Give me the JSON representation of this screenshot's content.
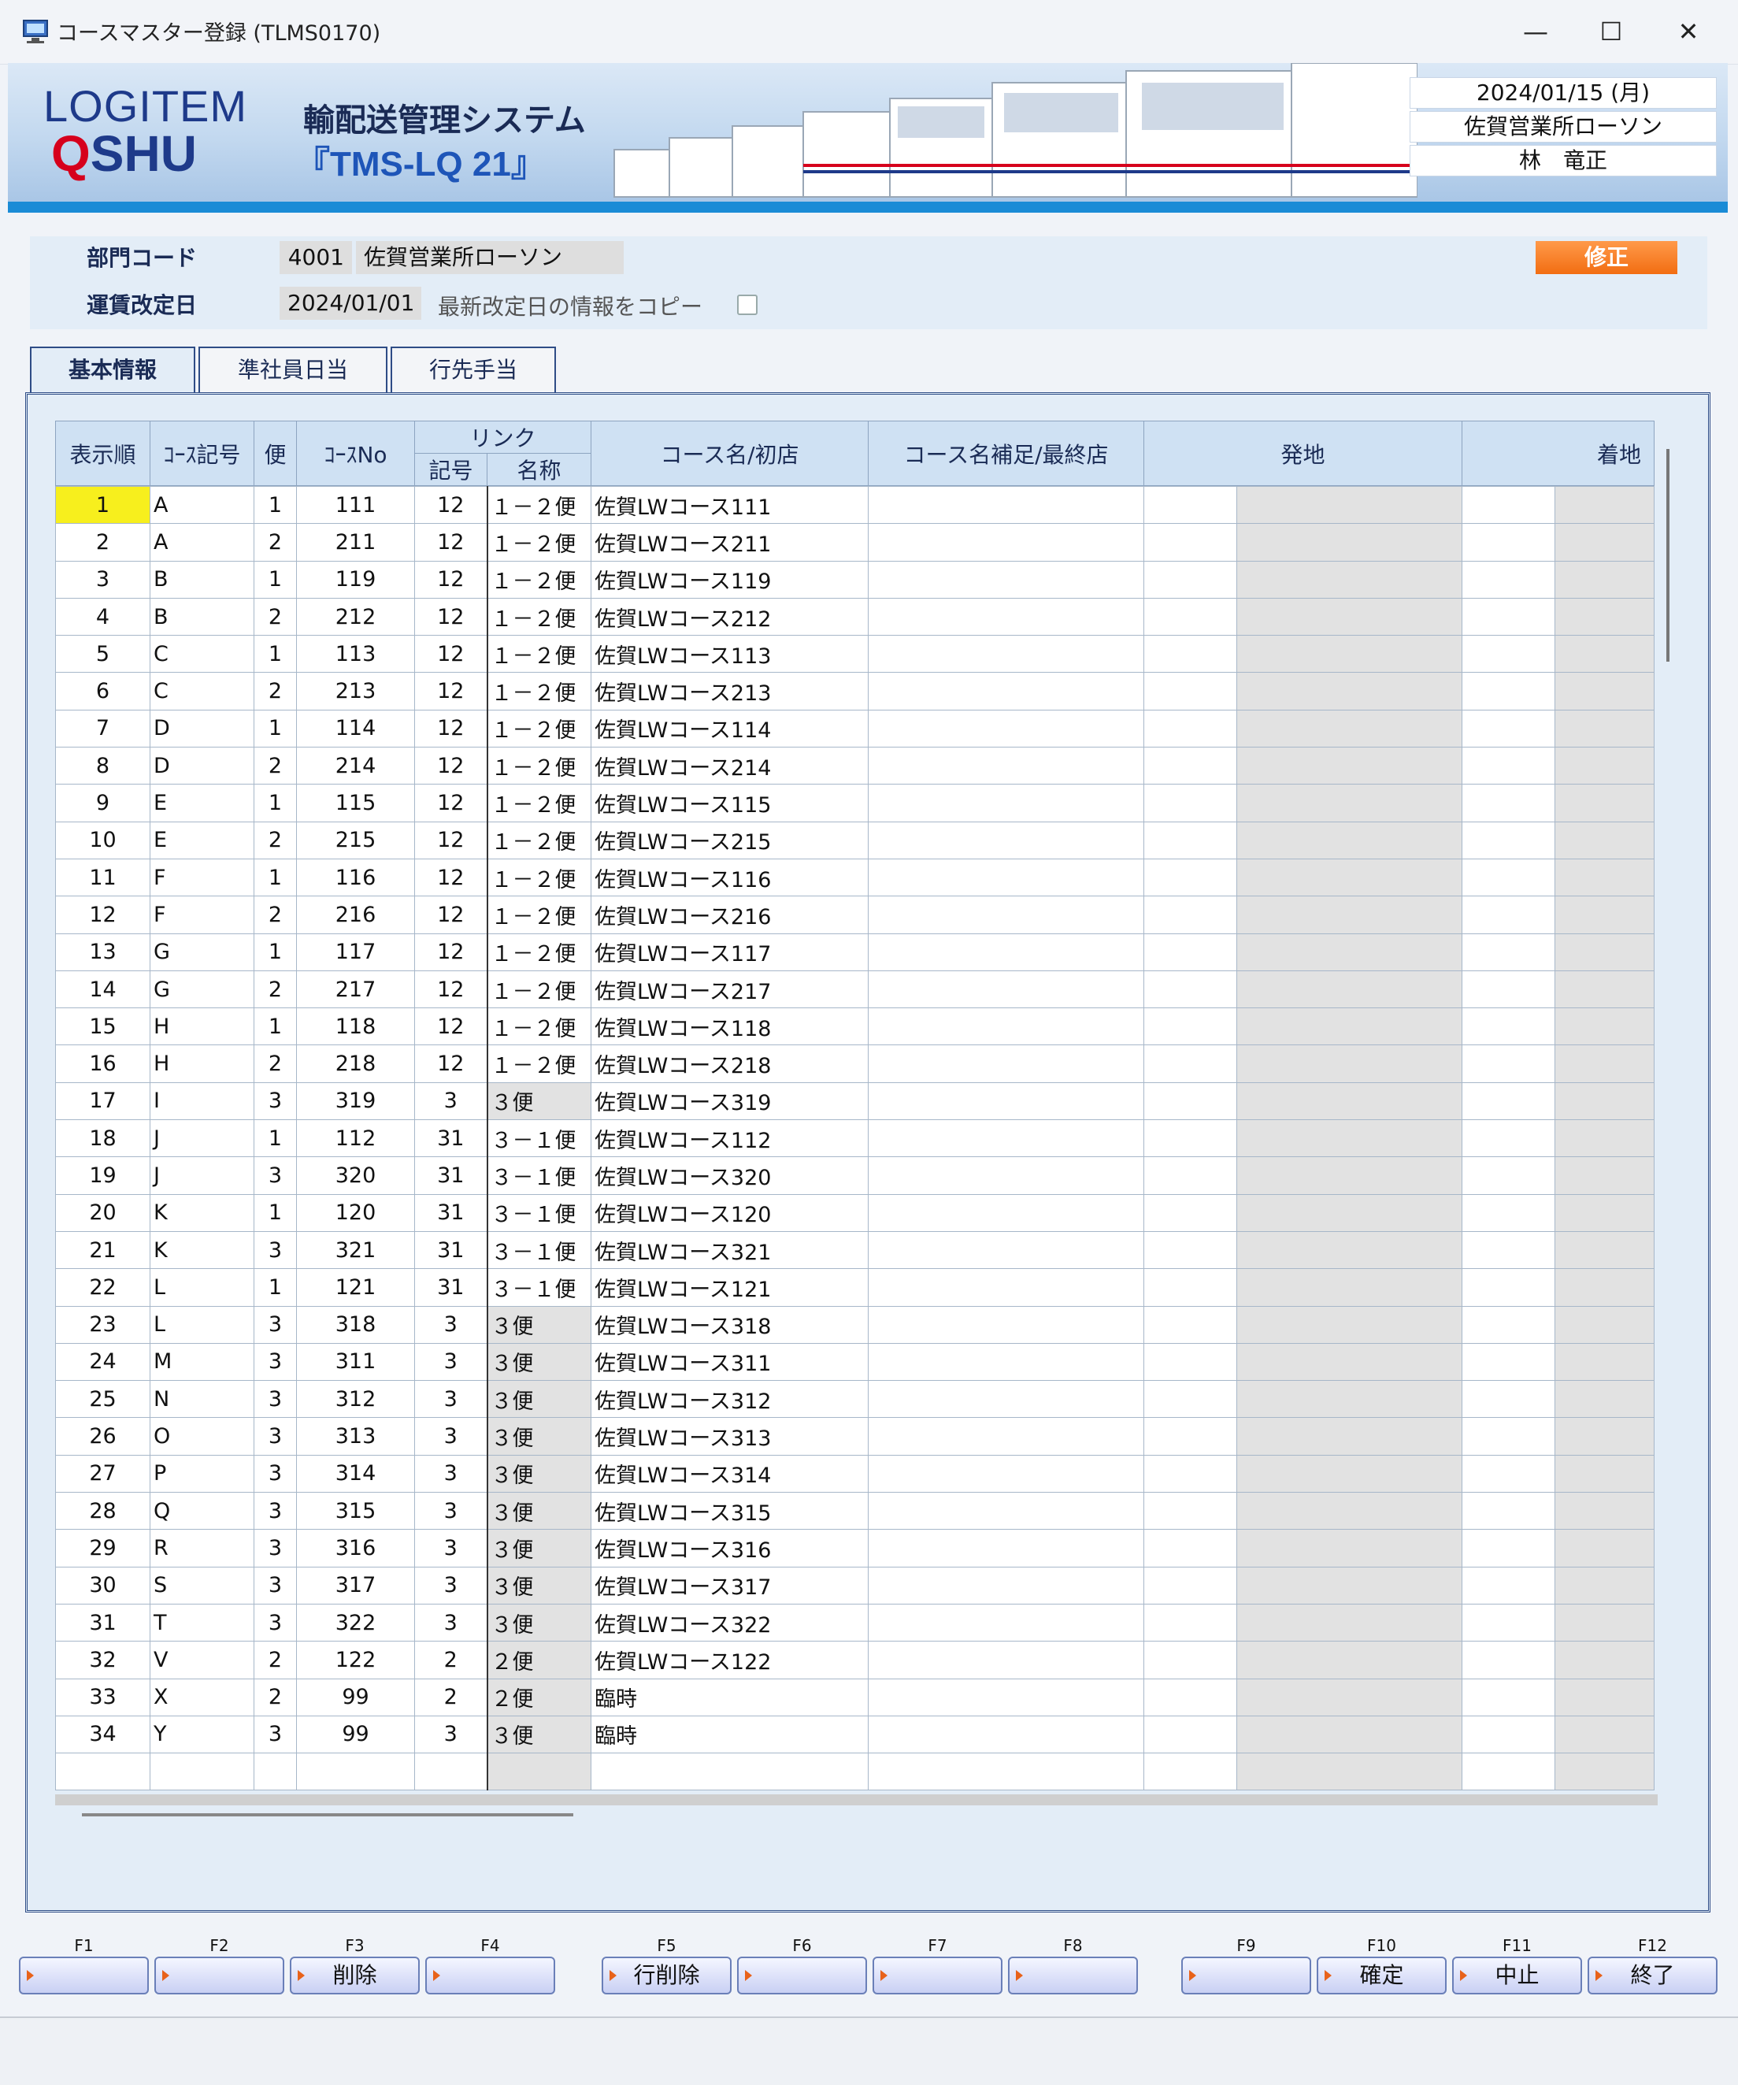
{
  "window": {
    "title": "コースマスター登録 (TLMS0170)"
  },
  "banner": {
    "logo_line1": "LOGITEM",
    "logo_line2_q": "Q",
    "logo_line2_rest": "SHU",
    "system_name": "輸配送管理システム",
    "system_code": "『TMS-LQ 21』",
    "date": "2024/01/15 (月)",
    "office": "佐賀営業所ローソン",
    "user": "林　竜正"
  },
  "header": {
    "dept_label": "部門コード",
    "dept_code": "4001",
    "dept_name": "佐賀営業所ローソン",
    "rate_label": "運賃改定日",
    "rate_date": "2024/01/01",
    "copy_label": "最新改定日の情報をコピー",
    "edit_button": "修正"
  },
  "tabs": [
    "基本情報",
    "準社員日当",
    "行先手当"
  ],
  "grid": {
    "headers": {
      "order": "表示順",
      "course_code": "ｺｰｽ記号",
      "trip": "便",
      "course_no": "ｺｰｽNo",
      "link": "リンク",
      "link_code": "記号",
      "link_name": "名称",
      "course_name": "コース名/初店",
      "course_note": "コース名補足/最終店",
      "origin": "発地",
      "dest": "着地"
    },
    "rows": [
      [
        "1",
        "A",
        "1",
        "111",
        "12",
        "１－２便",
        "佐賀LWコース111"
      ],
      [
        "2",
        "A",
        "2",
        "211",
        "12",
        "１－２便",
        "佐賀LWコース211"
      ],
      [
        "3",
        "B",
        "1",
        "119",
        "12",
        "１－２便",
        "佐賀LWコース119"
      ],
      [
        "4",
        "B",
        "2",
        "212",
        "12",
        "１－２便",
        "佐賀LWコース212"
      ],
      [
        "5",
        "C",
        "1",
        "113",
        "12",
        "１－２便",
        "佐賀LWコース113"
      ],
      [
        "6",
        "C",
        "2",
        "213",
        "12",
        "１－２便",
        "佐賀LWコース213"
      ],
      [
        "7",
        "D",
        "1",
        "114",
        "12",
        "１－２便",
        "佐賀LWコース114"
      ],
      [
        "8",
        "D",
        "2",
        "214",
        "12",
        "１－２便",
        "佐賀LWコース214"
      ],
      [
        "9",
        "E",
        "1",
        "115",
        "12",
        "１－２便",
        "佐賀LWコース115"
      ],
      [
        "10",
        "E",
        "2",
        "215",
        "12",
        "１－２便",
        "佐賀LWコース215"
      ],
      [
        "11",
        "F",
        "1",
        "116",
        "12",
        "１－２便",
        "佐賀LWコース116"
      ],
      [
        "12",
        "F",
        "2",
        "216",
        "12",
        "１－２便",
        "佐賀LWコース216"
      ],
      [
        "13",
        "G",
        "1",
        "117",
        "12",
        "１－２便",
        "佐賀LWコース117"
      ],
      [
        "14",
        "G",
        "2",
        "217",
        "12",
        "１－２便",
        "佐賀LWコース217"
      ],
      [
        "15",
        "H",
        "1",
        "118",
        "12",
        "１－２便",
        "佐賀LWコース118"
      ],
      [
        "16",
        "H",
        "2",
        "218",
        "12",
        "１－２便",
        "佐賀LWコース218"
      ],
      [
        "17",
        "I",
        "3",
        "319",
        "3",
        "３便",
        "佐賀LWコース319"
      ],
      [
        "18",
        "J",
        "1",
        "112",
        "31",
        "３－１便",
        "佐賀LWコース112"
      ],
      [
        "19",
        "J",
        "3",
        "320",
        "31",
        "３－１便",
        "佐賀LWコース320"
      ],
      [
        "20",
        "K",
        "1",
        "120",
        "31",
        "３－１便",
        "佐賀LWコース120"
      ],
      [
        "21",
        "K",
        "3",
        "321",
        "31",
        "３－１便",
        "佐賀LWコース321"
      ],
      [
        "22",
        "L",
        "1",
        "121",
        "31",
        "３－１便",
        "佐賀LWコース121"
      ],
      [
        "23",
        "L",
        "3",
        "318",
        "3",
        "３便",
        "佐賀LWコース318"
      ],
      [
        "24",
        "M",
        "3",
        "311",
        "3",
        "３便",
        "佐賀LWコース311"
      ],
      [
        "25",
        "N",
        "3",
        "312",
        "3",
        "３便",
        "佐賀LWコース312"
      ],
      [
        "26",
        "O",
        "3",
        "313",
        "3",
        "３便",
        "佐賀LWコース313"
      ],
      [
        "27",
        "P",
        "3",
        "314",
        "3",
        "３便",
        "佐賀LWコース314"
      ],
      [
        "28",
        "Q",
        "3",
        "315",
        "3",
        "３便",
        "佐賀LWコース315"
      ],
      [
        "29",
        "R",
        "3",
        "316",
        "3",
        "３便",
        "佐賀LWコース316"
      ],
      [
        "30",
        "S",
        "3",
        "317",
        "3",
        "３便",
        "佐賀LWコース317"
      ],
      [
        "31",
        "T",
        "3",
        "322",
        "3",
        "３便",
        "佐賀LWコース322"
      ],
      [
        "32",
        "V",
        "2",
        "122",
        "2",
        "２便",
        "佐賀LWコース122"
      ],
      [
        "33",
        "X",
        "2",
        "99",
        "2",
        "２便",
        "臨時"
      ],
      [
        "34",
        "Y",
        "3",
        "99",
        "3",
        "３便",
        "臨時"
      ]
    ]
  },
  "fkeys": [
    {
      "key": "F1",
      "label": ""
    },
    {
      "key": "F2",
      "label": ""
    },
    {
      "key": "F3",
      "label": "削除"
    },
    {
      "key": "F4",
      "label": ""
    },
    {
      "key": "F5",
      "label": "行削除"
    },
    {
      "key": "F6",
      "label": ""
    },
    {
      "key": "F7",
      "label": ""
    },
    {
      "key": "F8",
      "label": ""
    },
    {
      "key": "F9",
      "label": ""
    },
    {
      "key": "F10",
      "label": "確定"
    },
    {
      "key": "F11",
      "label": "中止"
    },
    {
      "key": "F12",
      "label": "終了"
    }
  ],
  "colors": {
    "accent_orange": "#f26d12",
    "selection_yellow": "#f7ef1d",
    "frame_blue": "#2e4c86",
    "banner_stripe": "#1a8bd6"
  }
}
